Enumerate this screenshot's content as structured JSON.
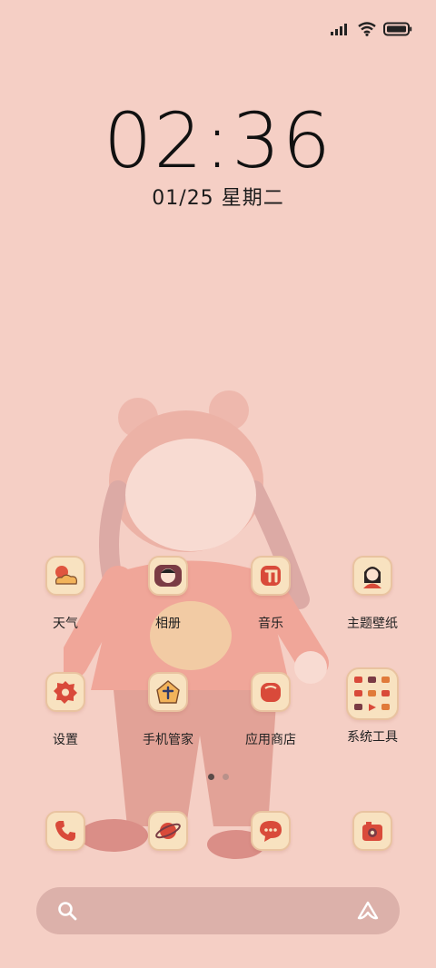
{
  "clock": {
    "time": "02:36"
  },
  "date": {
    "day": "01/25",
    "weekday": "星期二"
  },
  "apps": [
    {
      "label": "天气",
      "icon": "weather-icon"
    },
    {
      "label": "相册",
      "icon": "gallery-icon"
    },
    {
      "label": "音乐",
      "icon": "music-icon"
    },
    {
      "label": "主题壁纸",
      "icon": "themes-icon"
    },
    {
      "label": "设置",
      "icon": "settings-icon"
    },
    {
      "label": "手机管家",
      "icon": "security-icon"
    },
    {
      "label": "应用商店",
      "icon": "app-store-icon"
    },
    {
      "label": "系统工具",
      "icon": "tools-folder-icon"
    }
  ],
  "dock": [
    {
      "icon": "phone-icon"
    },
    {
      "icon": "browser-icon"
    },
    {
      "icon": "messages-icon"
    },
    {
      "icon": "camera-icon"
    }
  ],
  "pager": {
    "count": 2,
    "active": 1
  },
  "colors": {
    "background": "#f5cfc5",
    "icon_bg": "#f8e2c0",
    "accent_red": "#d94a3a",
    "search_bar": "#dcb1aa"
  }
}
